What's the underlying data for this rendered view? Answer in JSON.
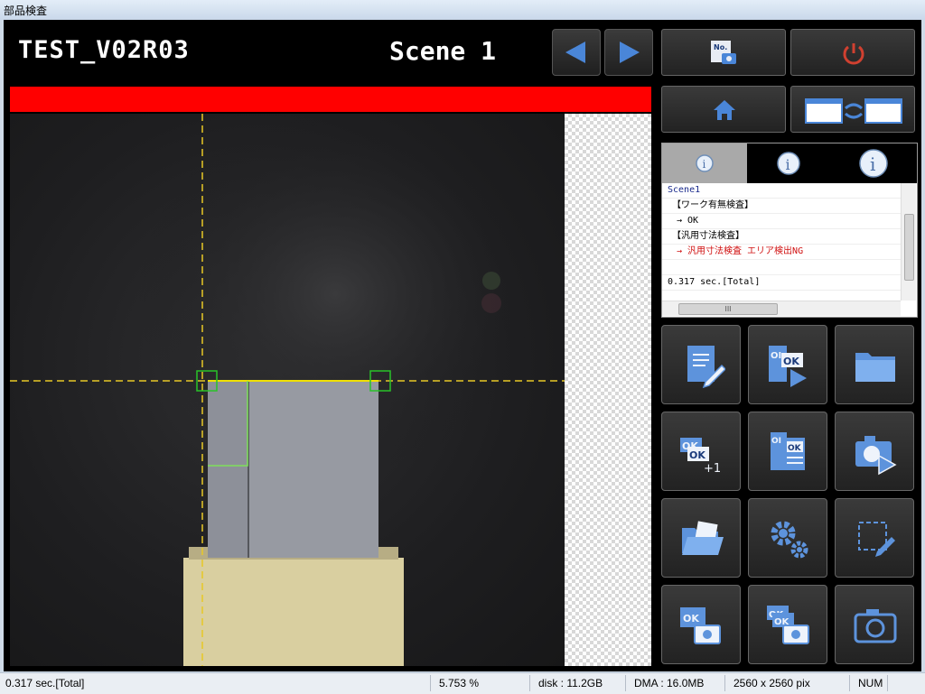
{
  "window": {
    "title": "部品検査"
  },
  "header": {
    "project": "TEST_V02R03",
    "scene": "Scene  1"
  },
  "status": {
    "judgement_color": "#ff0000"
  },
  "side_buttons": {
    "scene_no": "scene-number-camera-icon",
    "power": "power-icon",
    "home": "home-icon",
    "switch_layout": "layout-switch-icon"
  },
  "info": {
    "tabs": [
      "info-tab-1",
      "info-tab-2",
      "info-tab-3"
    ],
    "log": [
      {
        "text": "Scene1",
        "color": "#1a2b8c"
      },
      {
        "text": "　【ワーク有無検査】",
        "color": "#000000"
      },
      {
        "text": "　→ OK",
        "color": "#000000"
      },
      {
        "text": "　【汎用寸法検査】",
        "color": "#000000"
      },
      {
        "text": "　→ 汎用寸法検査 エリア検出NG",
        "color": "#d01010"
      },
      {
        "text": "",
        "color": "#000000"
      },
      {
        "text": "0.317 sec.[Total]",
        "color": "#000000"
      }
    ],
    "hscroll_label": "III"
  },
  "toolbar_icons": [
    "edit-flow-icon",
    "ok-run-icon",
    "folder-icon",
    "ok-plus-one-icon",
    "ok-list-icon",
    "camera-play-icon",
    "open-folder-icon",
    "settings-gears-icon",
    "roi-edit-icon",
    "ok-camera-icon",
    "ok-multi-camera-icon",
    "camera-icon"
  ],
  "statusbar": {
    "time": "0.317 sec.[Total]",
    "zoom": "5.753 %",
    "disk": "disk : 11.2GB",
    "dma": "DMA : 16.0MB",
    "resolution": "2560 x 2560 pix",
    "num": "NUM"
  }
}
